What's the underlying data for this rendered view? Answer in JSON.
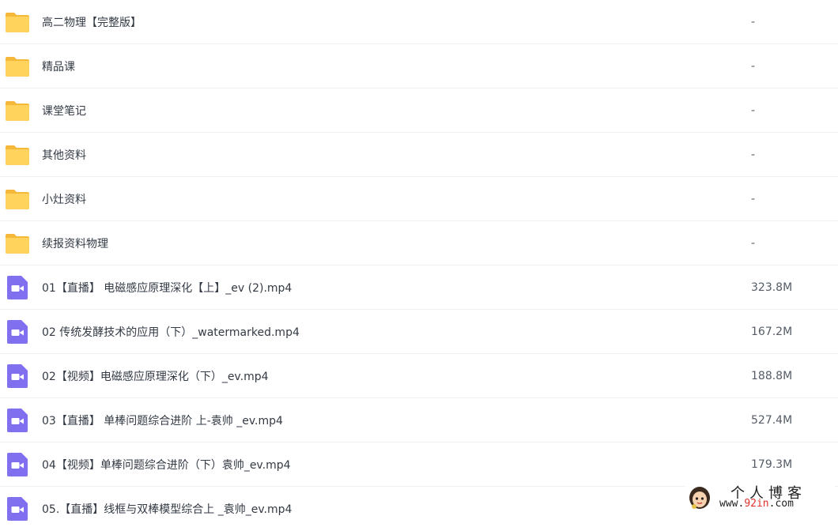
{
  "colors": {
    "folder": "#ffcf55",
    "folder_tab": "#f5b83a",
    "video": "#8070f0",
    "divider": "#eef0f4",
    "watermark_accent": "#e0302a"
  },
  "files": [
    {
      "name": "高二物理【完整版】",
      "size": "-",
      "icon": "folder-icon"
    },
    {
      "name": "精品课",
      "size": "-",
      "icon": "folder-icon"
    },
    {
      "name": "课堂笔记",
      "size": "-",
      "icon": "folder-icon"
    },
    {
      "name": "其他资料",
      "size": "-",
      "icon": "folder-icon"
    },
    {
      "name": "小灶资料",
      "size": "-",
      "icon": "folder-icon"
    },
    {
      "name": "续报资料物理",
      "size": "-",
      "icon": "folder-icon"
    },
    {
      "name": "01【直播】 电磁感应原理深化【上】_ev (2).mp4",
      "size": "323.8M",
      "icon": "video-file-icon"
    },
    {
      "name": "02 传统发酵技术的应用（下）_watermarked.mp4",
      "size": "167.2M",
      "icon": "video-file-icon"
    },
    {
      "name": "02【视频】电磁感应原理深化（下）_ev.mp4",
      "size": "188.8M",
      "icon": "video-file-icon"
    },
    {
      "name": "03【直播】 单棒问题综合进阶 上-袁帅 _ev.mp4",
      "size": "527.4M",
      "icon": "video-file-icon"
    },
    {
      "name": "04【视频】单棒问题综合进阶（下）袁帅_ev.mp4",
      "size": "179.3M",
      "icon": "video-file-icon"
    },
    {
      "name": "05.【直播】线框与双棒模型综合上 _袁帅_ev.mp4",
      "size": "",
      "icon": "video-file-icon"
    }
  ],
  "watermark": {
    "title": "个人博客",
    "url_prefix": "www.",
    "url_accent": "92in",
    "url_suffix": ".com"
  }
}
